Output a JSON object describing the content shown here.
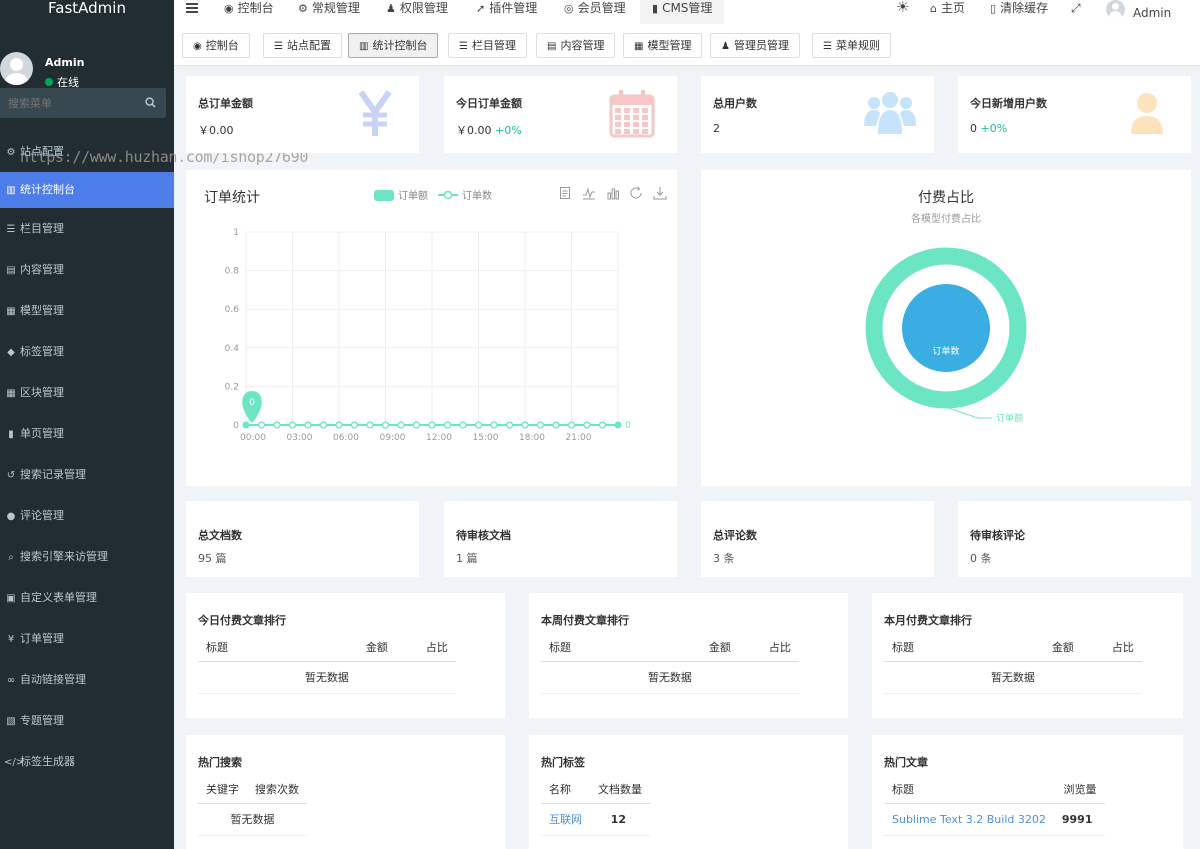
{
  "app": {
    "logo": "FastAdmin"
  },
  "sidebar": {
    "user_name": "Admin",
    "user_status": "在线",
    "search_placeholder": "搜索菜单",
    "watermark": "https://www.huzhan.com/ishop27690",
    "items": [
      {
        "label": "站点配置",
        "icon": "cogs-icon",
        "glyph": "⚙"
      },
      {
        "label": "统计控制台",
        "icon": "bar-chart-icon",
        "glyph": "▥"
      },
      {
        "label": "栏目管理",
        "icon": "list-icon",
        "glyph": "☰"
      },
      {
        "label": "内容管理",
        "icon": "file-icon",
        "glyph": "▤"
      },
      {
        "label": "模型管理",
        "icon": "th-icon",
        "glyph": "▦"
      },
      {
        "label": "标签管理",
        "icon": "tags-icon",
        "glyph": "◆"
      },
      {
        "label": "区块管理",
        "icon": "th-large-icon",
        "glyph": "▦"
      },
      {
        "label": "单页管理",
        "icon": "file-text-icon",
        "glyph": "▮"
      },
      {
        "label": "搜索记录管理",
        "icon": "history-icon",
        "glyph": "↺"
      },
      {
        "label": "评论管理",
        "icon": "comment-icon",
        "glyph": "●"
      },
      {
        "label": "搜索引擎来访管理",
        "icon": "search-icon",
        "glyph": "⌕"
      },
      {
        "label": "自定义表单管理",
        "icon": "list-alt-icon",
        "glyph": "▣"
      },
      {
        "label": "订单管理",
        "icon": "cny-icon",
        "glyph": "¥"
      },
      {
        "label": "自动链接管理",
        "icon": "link-icon",
        "glyph": "∞"
      },
      {
        "label": "专题管理",
        "icon": "newspaper-icon",
        "glyph": "▧"
      },
      {
        "label": "标签生成器",
        "icon": "code-icon",
        "glyph": "</>"
      }
    ],
    "active_index": 1
  },
  "topbar": {
    "nav": [
      {
        "label": "控制台",
        "icon": "dashboard-icon",
        "glyph": "◉"
      },
      {
        "label": "常规管理",
        "icon": "cogs-icon",
        "glyph": "⚙"
      },
      {
        "label": "权限管理",
        "icon": "group-icon",
        "glyph": "♟"
      },
      {
        "label": "插件管理",
        "icon": "rocket-icon",
        "glyph": "➚"
      },
      {
        "label": "会员管理",
        "icon": "user-circle-icon",
        "glyph": "◎"
      },
      {
        "label": "CMS管理",
        "icon": "file-icon",
        "glyph": "▮"
      }
    ],
    "home_label": "主页",
    "clear_cache_label": "清除缓存",
    "admin_label": "Admin"
  },
  "subtabs": [
    {
      "label": "控制台",
      "icon": "dashboard-icon",
      "glyph": "◉"
    },
    {
      "label": "站点配置",
      "icon": "list-icon",
      "glyph": "☰"
    },
    {
      "label": "统计控制台",
      "icon": "bar-chart-icon",
      "glyph": "▥"
    },
    {
      "label": "栏目管理",
      "icon": "list-icon",
      "glyph": "☰"
    },
    {
      "label": "内容管理",
      "icon": "file-icon",
      "glyph": "▤"
    },
    {
      "label": "模型管理",
      "icon": "th-icon",
      "glyph": "▦"
    },
    {
      "label": "管理员管理",
      "icon": "user-icon",
      "glyph": "♟"
    },
    {
      "label": "菜单规则",
      "icon": "list-icon",
      "glyph": "☰"
    }
  ],
  "stats": [
    {
      "title": "总订单金额",
      "value": "￥0.00",
      "pct": "",
      "icon": "yen-icon",
      "color": "#c8d3f5"
    },
    {
      "title": "今日订单金额",
      "value": "￥0.00 ",
      "pct": "+0%",
      "icon": "calendar-icon",
      "color": "#f7c6c6"
    },
    {
      "title": "总用户数",
      "value": "2",
      "pct": "",
      "icon": "users-icon",
      "color": "#c6e3fb"
    },
    {
      "title": "今日新增用户数",
      "value": "0 ",
      "pct": "+0%",
      "icon": "user-icon",
      "color": "#fde3bd"
    }
  ],
  "order_chart": {
    "title": "订单统计",
    "toolbox_icons": [
      "data-view-icon",
      "line-icon",
      "bar-icon",
      "restore-icon",
      "download-icon"
    ]
  },
  "chart_data": [
    {
      "type": "line",
      "title": "订单统计",
      "series": [
        {
          "name": "订单额",
          "kind": "area",
          "color": "#6ce5c5",
          "values": [
            0,
            0,
            0,
            0,
            0,
            0,
            0,
            0,
            0,
            0,
            0,
            0,
            0,
            0,
            0,
            0,
            0,
            0,
            0,
            0,
            0,
            0,
            0,
            0,
            0
          ]
        },
        {
          "name": "订单数",
          "kind": "line",
          "color": "#6ce5c5",
          "values": [
            0,
            0,
            0,
            0,
            0,
            0,
            0,
            0,
            0,
            0,
            0,
            0,
            0,
            0,
            0,
            0,
            0,
            0,
            0,
            0,
            0,
            0,
            0,
            0,
            0
          ]
        }
      ],
      "x_ticks": [
        "00:00",
        "03:00",
        "06:00",
        "09:00",
        "12:00",
        "15:00",
        "18:00",
        "21:00"
      ],
      "y_ticks": [
        "0",
        "0.2",
        "0.4",
        "0.6",
        "0.8",
        "1"
      ],
      "ylim": [
        0,
        1
      ],
      "point_count": 25,
      "max_marker": "0",
      "end_label": "0",
      "grid": true,
      "legend": "top-center"
    },
    {
      "type": "pie",
      "title": "付费占比",
      "subtitle": "各模型付费占比",
      "series": [
        {
          "name": "订单数",
          "ring": "inner",
          "color": "#3aade2"
        },
        {
          "name": "订单额",
          "ring": "outer",
          "color": "#6ce5c5"
        }
      ]
    }
  ],
  "docs": [
    {
      "title": "总文档数",
      "value": "95 篇"
    },
    {
      "title": "待审核文档",
      "value": "1 篇"
    },
    {
      "title": "总评论数",
      "value": "3 条"
    },
    {
      "title": "待审核评论",
      "value": "0 条"
    }
  ],
  "rank_tables": [
    {
      "title": "今日付费文章排行",
      "cols": [
        "标题",
        "金额",
        "占比"
      ],
      "empty": "暂无数据"
    },
    {
      "title": "本周付费文章排行",
      "cols": [
        "标题",
        "金额",
        "占比"
      ],
      "empty": "暂无数据"
    },
    {
      "title": "本月付费文章排行",
      "cols": [
        "标题",
        "金额",
        "占比"
      ],
      "empty": "暂无数据"
    }
  ],
  "hot": {
    "search": {
      "title": "热门搜索",
      "cols": [
        "关键字",
        "搜索次数"
      ],
      "empty": "暂无数据"
    },
    "tags": {
      "title": "热门标签",
      "cols": [
        "名称",
        "文档数量"
      ],
      "rows": [
        {
          "name": "互联网",
          "count": "12"
        }
      ]
    },
    "articles": {
      "title": "热门文章",
      "cols": [
        "标题",
        "浏览量"
      ],
      "rows": [
        {
          "name": "Sublime Text 3.2 Build 3202",
          "count": "9991"
        }
      ]
    }
  }
}
